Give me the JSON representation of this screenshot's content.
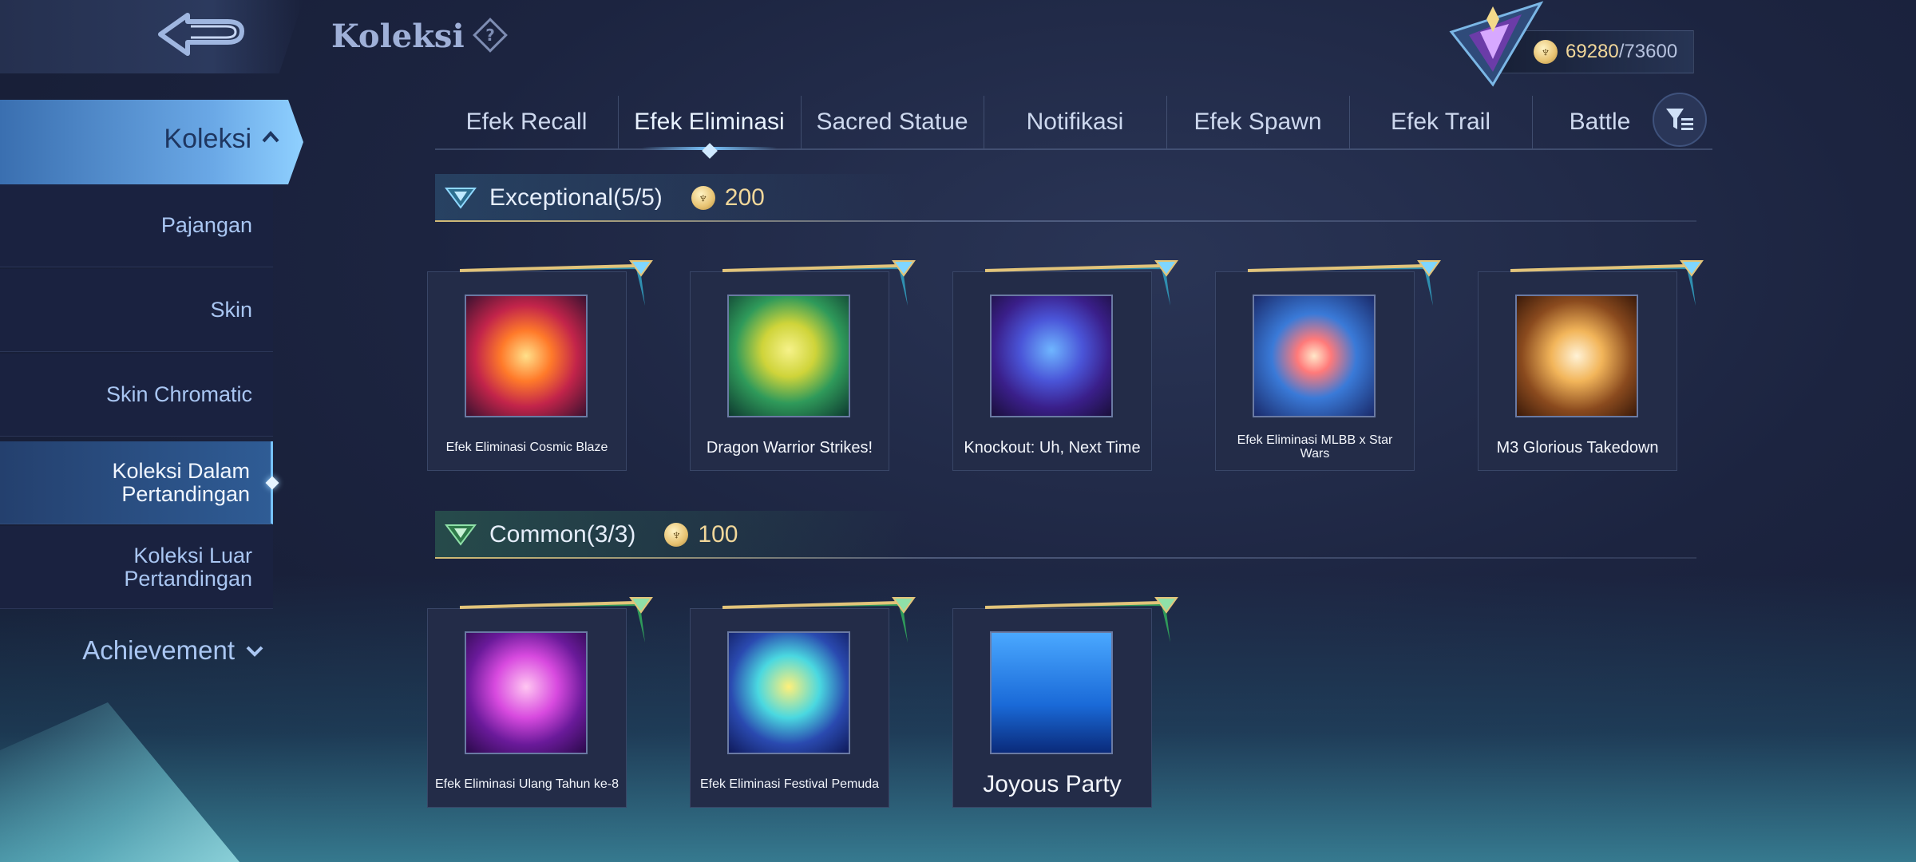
{
  "header": {
    "title": "Koleksi"
  },
  "currency": {
    "amount": "69280",
    "separator": "/",
    "max": "73600"
  },
  "sidebar": {
    "main_label": "Koleksi",
    "items": [
      {
        "label": "Pajangan"
      },
      {
        "label": "Skin"
      },
      {
        "label": "Skin Chromatic"
      },
      {
        "label": "Koleksi Dalam Pertandingan"
      },
      {
        "label": "Koleksi Luar Pertandingan"
      }
    ],
    "achievement_label": "Achievement",
    "active_index": 3
  },
  "tabs": [
    {
      "label": "Efek Recall"
    },
    {
      "label": "Efek Eliminasi"
    },
    {
      "label": "Sacred Statue"
    },
    {
      "label": "Notifikasi"
    },
    {
      "label": "Efek Spawn"
    },
    {
      "label": "Efek Trail"
    },
    {
      "label": "Battle"
    }
  ],
  "active_tab": "Efek Eliminasi",
  "sections": [
    {
      "title": "Exceptional",
      "count": "(5/5)",
      "points": "200",
      "items": [
        {
          "name": "Efek Eliminasi Cosmic Blaze"
        },
        {
          "name": "Dragon Warrior Strikes!"
        },
        {
          "name": "Knockout: Uh, Next Time"
        },
        {
          "name": "Efek Eliminasi MLBB x Star Wars"
        },
        {
          "name": "M3 Glorious Takedown"
        }
      ]
    },
    {
      "title": "Common",
      "count": "(3/3)",
      "points": "100",
      "items": [
        {
          "name": "Efek Eliminasi Ulang Tahun ke-8"
        },
        {
          "name": "Efek Eliminasi Festival Pemuda"
        },
        {
          "name": "Joyous Party"
        }
      ]
    }
  ],
  "colors": {
    "accent_blue": "#7cc6ff",
    "gold": "#f1d79a",
    "exceptional_ribbon": "#2f8fb0",
    "common_ribbon": "#2f9a5a"
  }
}
